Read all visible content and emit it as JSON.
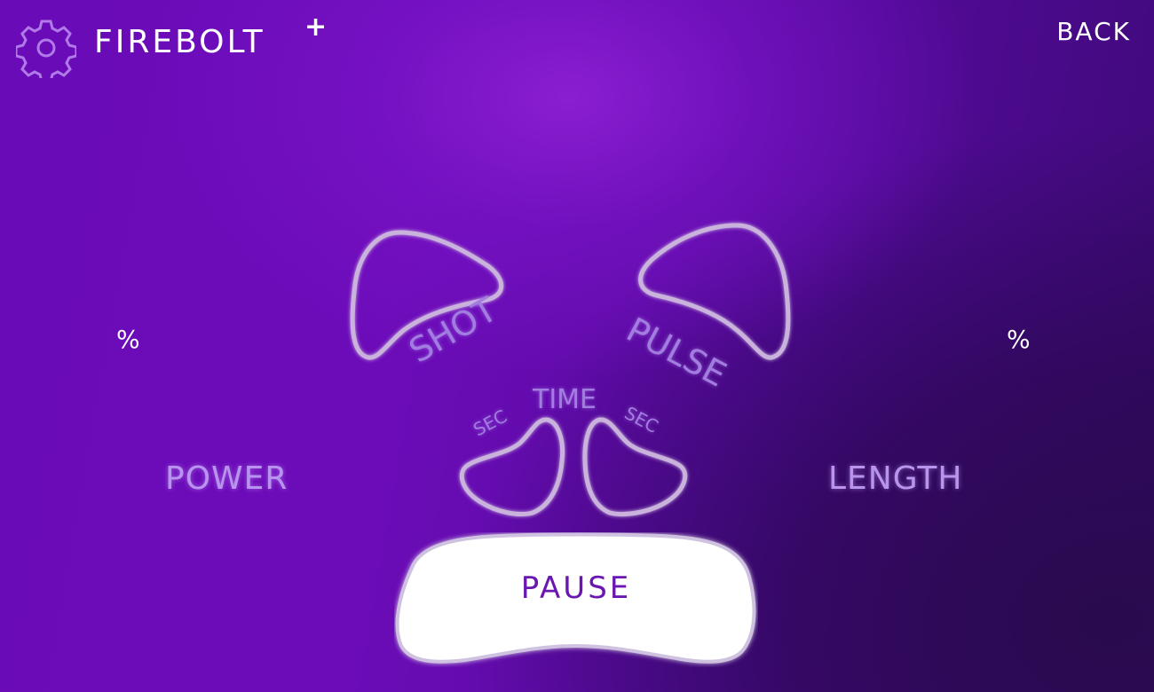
{
  "header": {
    "brand": "FIREBOLT",
    "brand_plus": "+",
    "back_label": "BACK"
  },
  "icons": {
    "settings": "gear-icon"
  },
  "power": {
    "label": "POWER",
    "unit": "%"
  },
  "length": {
    "label": "LENGTH",
    "unit": "%"
  },
  "mode": {
    "shot_label": "SHOT",
    "pulse_label": "PULSE"
  },
  "time": {
    "label": "TIME",
    "left_unit": "SEC",
    "right_unit": "SEC"
  },
  "action": {
    "pause_label": "PAUSE"
  },
  "colors": {
    "background": "#6a0bb8",
    "accent_text": "#b894ee",
    "outline": "#c9b3dd",
    "pause_fill": "#ffffff",
    "pause_text": "#6a16b0"
  }
}
